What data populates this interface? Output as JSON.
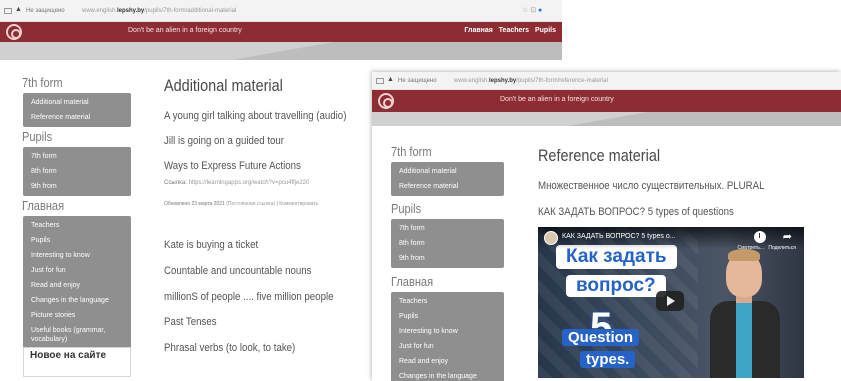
{
  "colors": {
    "header_red": "#8e2c33",
    "menu_gray": "#8f8f8f",
    "accent_blue": "#2563c9"
  },
  "icons": [
    "tab-icon",
    "warning-triangle-icon",
    "site-logo-icon",
    "shield-icon",
    "play-icon",
    "clock-icon",
    "share-icon",
    "channel-avatar-icon"
  ],
  "left": {
    "browser": {
      "not_secure": "Не защищено",
      "url_prefix": "www.english.",
      "url_bold": "lepshy.by",
      "url_rest": "/pupils/7th-form/additional-material",
      "controls": "☆ ⊡"
    },
    "header": {
      "slogan": "Don't be an alien in a foreign country",
      "nav": [
        "Главная",
        "Teachers",
        "Pupils"
      ]
    },
    "sidebar": {
      "sections": [
        {
          "title": "7th form",
          "items": [
            "Additional material",
            "Reference material"
          ]
        },
        {
          "title": "Pupils",
          "items": [
            "7th form",
            "8th form",
            "9th from"
          ]
        },
        {
          "title": "Главная",
          "items": [
            "Teachers",
            "Pupils",
            "Interesting to know",
            "Just for fun",
            "Read and enjoy",
            "Changes in the language",
            "Picture stories",
            "Useful books (grammar, vocabulary)"
          ]
        }
      ],
      "recent_title": "Новое на сайте"
    },
    "main": {
      "title": "Additional material",
      "links_top": [
        "A young girl talking about travelling (audio)",
        "Jill is going on a guided tour",
        "Ways to Express Future Actions"
      ],
      "link_caption_label": "Ссылка:",
      "link_caption_url": "https://learningapps.org/watch?v=pcu4ffje220",
      "updated": "Обновлено 23 марта 2021",
      "permalink": "(Постоянная ссылка)",
      "comment": "Комментировать",
      "links_bottom": [
        "Kate is buying a ticket",
        "Countable and uncountable nouns",
        "millionS of people .... five million people",
        "Past Tenses",
        "Phrasal verbs (to look, to take)"
      ]
    }
  },
  "right": {
    "browser": {
      "not_secure": "Не защищено",
      "url_prefix": "www.english.",
      "url_bold": "lepshy.by",
      "url_rest": "/pupils/7th-form/reference-material"
    },
    "header": {
      "slogan": "Don't be an alien in a foreign country"
    },
    "sidebar": {
      "sections": [
        {
          "title": "7th form",
          "items": [
            "Additional material",
            "Reference material"
          ]
        },
        {
          "title": "Pupils",
          "items": [
            "7th form",
            "8th form",
            "9th from"
          ]
        },
        {
          "title": "Главная",
          "items": [
            "Teachers",
            "Pupils",
            "Interesting to know",
            "Just for fun",
            "Read and enjoy",
            "Changes in the language"
          ]
        }
      ]
    },
    "main": {
      "title": "Reference material",
      "links": [
        "Множественное число существительных. PLURAL",
        "КАК ЗАДАТЬ ВОПРОС? 5 types of questions"
      ],
      "video": {
        "title": "КАК ЗАДАТЬ ВОПРОС? 5 types o...",
        "watch_later": "Смотреть...",
        "share": "Поделиться",
        "thumb_line1": "Как задать",
        "thumb_line2": "вопрос?",
        "thumb_number": "5",
        "thumb_line3": "Question",
        "thumb_line4": "types."
      }
    }
  }
}
